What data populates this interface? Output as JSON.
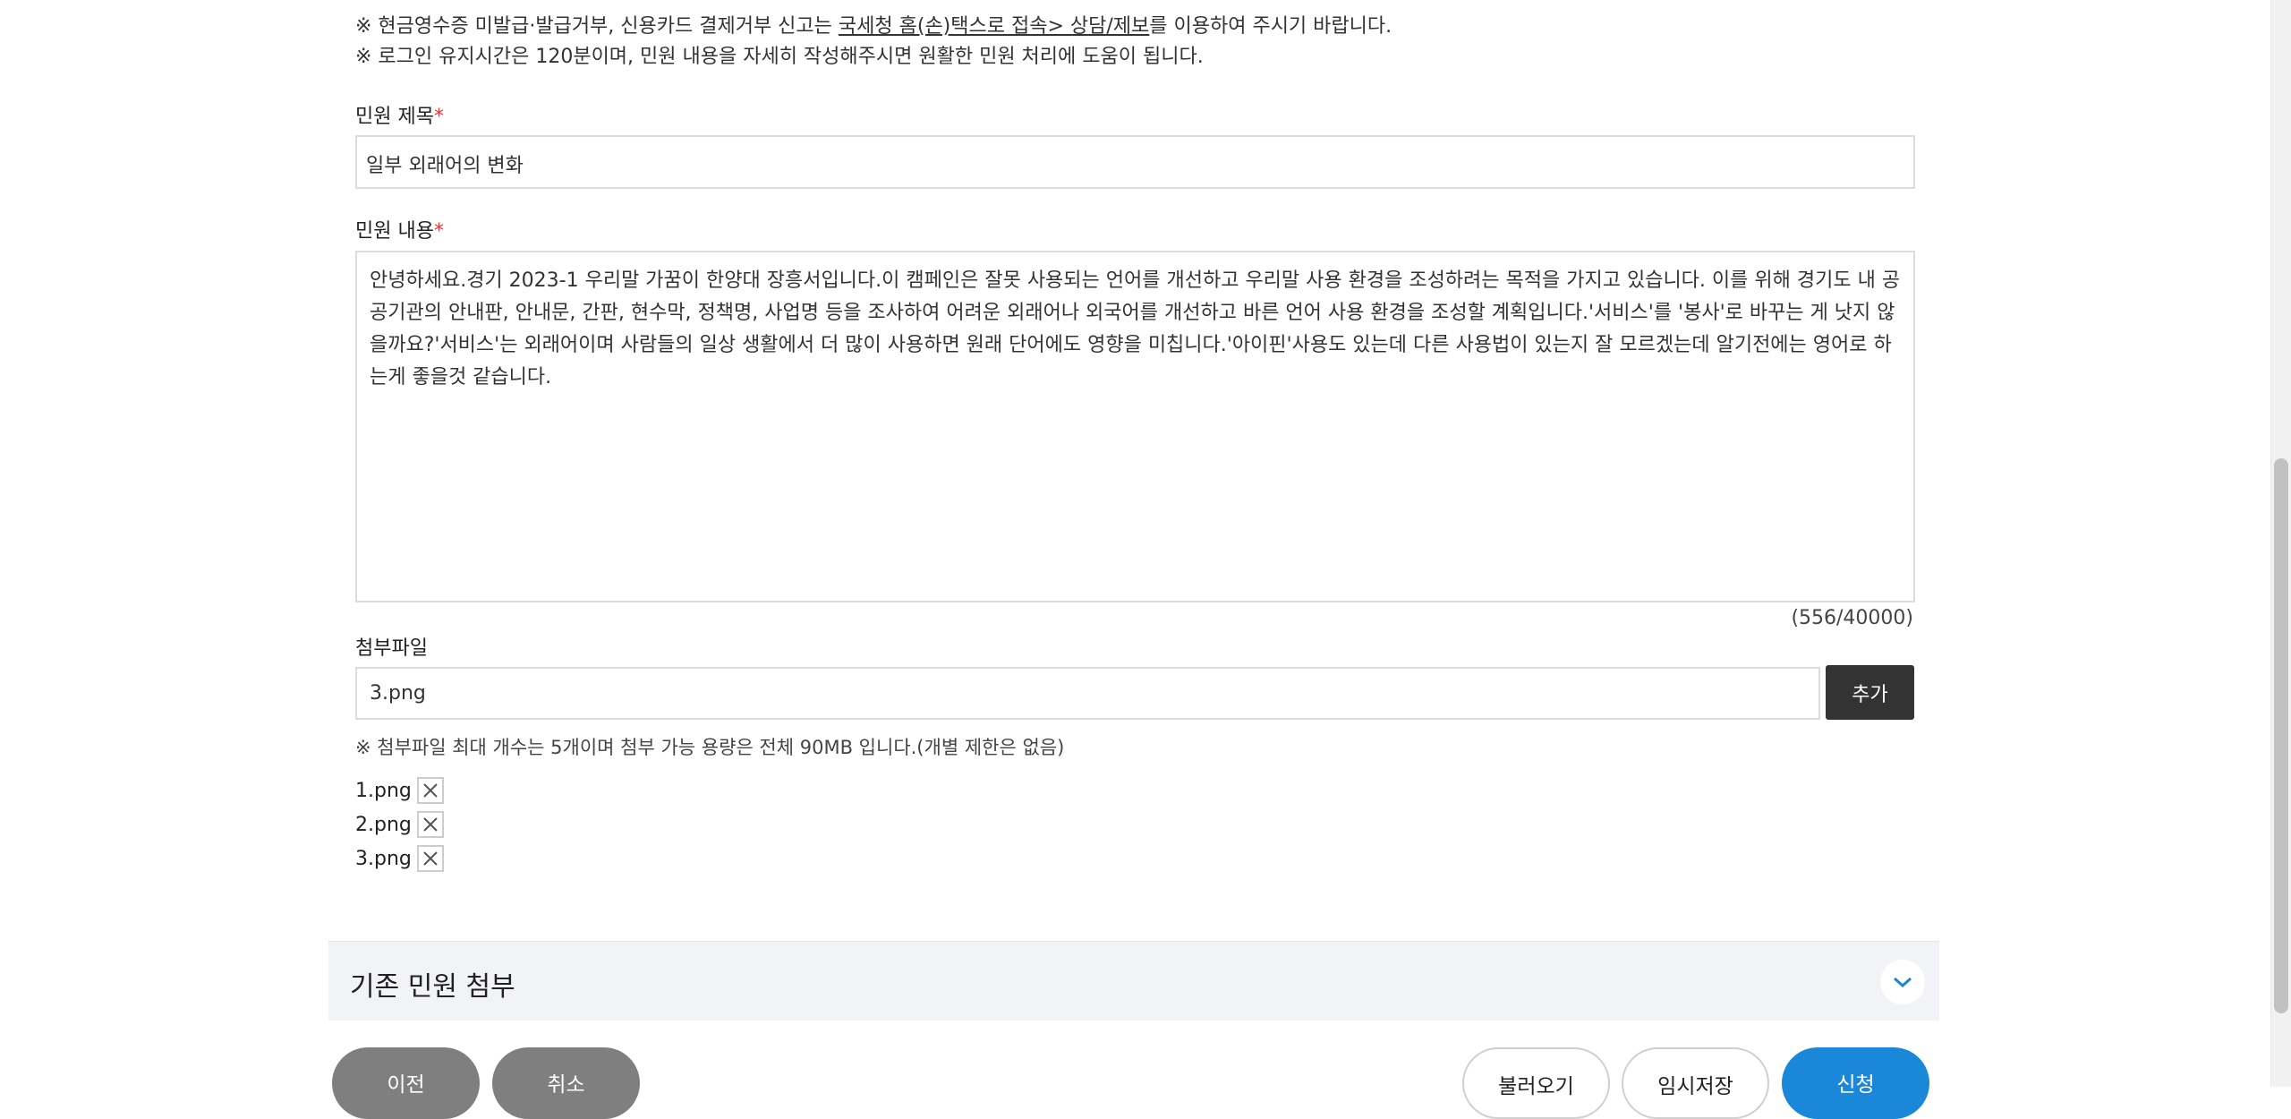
{
  "notices": {
    "line1_prefix": "※ 현금영수증 미발급·발급거부, 신용카드 결제거부 신고는 ",
    "line1_link": "국세청 홈(손)택스로 접속> 상담/제보",
    "line1_suffix": "를 이용하여 주시기 바랍니다.",
    "line2": "※ 로그인 유지시간은 120분이며, 민원 내용을 자세히 작성해주시면 원활한 민원 처리에 도움이 됩니다."
  },
  "form": {
    "title_label": "민원 제목",
    "required_mark": "*",
    "title_value": "일부 외래어의 변화",
    "content_label": "민원 내용",
    "content_value": "안녕하세요.경기 2023-1 우리말 가꿈이 한양대 장흥서입니다.이 캠페인은 잘못 사용되는 언어를 개선하고 우리말 사용 환경을 조성하려는 목적을 가지고 있습니다. 이를 위해 경기도 내 공공기관의 안내판, 안내문, 간판, 현수막, 정책명, 사업명 등을 조사하여 어려운 외래어나 외국어를 개선하고 바른 언어 사용 환경을 조성할 계획입니다.'서비스'를 '봉사'로 바꾸는 게 낫지 않을까요?'서비스'는 외래어이며 사람들의 일상 생활에서 더 많이 사용하면 원래 단어에도 영향을 미칩니다.'아이핀'사용도 있는데 다른 사용법이 있는지 잘 모르겠는데 알기전에는 영어로 하는게 좋을것 같습니다.",
    "char_count": "(556/40000)",
    "attach_label": "첨부파일",
    "attach_input_value": "3.png",
    "add_button": "추가",
    "attach_notice": "※ 첨부파일 최대 개수는 5개이며 첨부 가능 용량은 전체 90MB 입니다.(개별 제한은 없음)",
    "files": [
      "1.png",
      "2.png",
      "3.png"
    ]
  },
  "accordion": {
    "title": "기존 민원 첨부"
  },
  "buttons": {
    "prev": "이전",
    "cancel": "취소",
    "load": "불러오기",
    "temp_save": "임시저장",
    "submit": "신청"
  },
  "colors": {
    "accent_blue": "#1a87d8",
    "required_red": "#e23b3b",
    "dark_button": "#333333"
  }
}
